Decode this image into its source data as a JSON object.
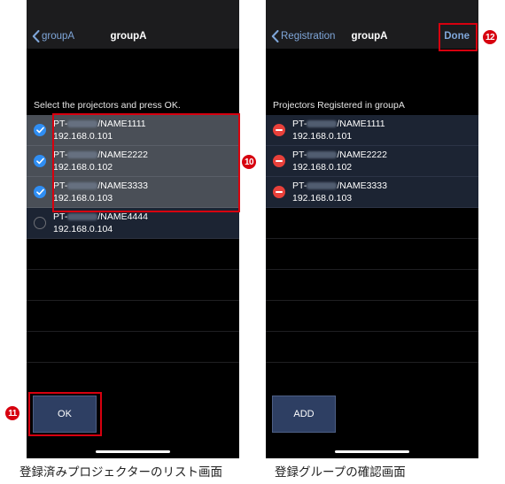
{
  "left_screen": {
    "nav": {
      "back_label": "groupA",
      "title": "groupA"
    },
    "section_header": "Select the projectors and press OK.",
    "projectors": [
      {
        "model_prefix": "PT-",
        "name": "/NAME1111",
        "ip": "192.168.0.101",
        "selected": true
      },
      {
        "model_prefix": "PT-",
        "name": "/NAME2222",
        "ip": "192.168.0.102",
        "selected": true
      },
      {
        "model_prefix": "PT-",
        "name": "/NAME3333",
        "ip": "192.168.0.103",
        "selected": true
      },
      {
        "model_prefix": "PT-",
        "name": "/NAME4444",
        "ip": "192.168.0.104",
        "selected": false
      }
    ],
    "ok_button_label": "OK",
    "caption": "登録済みプロジェクターのリスト画面"
  },
  "right_screen": {
    "nav": {
      "back_label": "Registration",
      "title": "groupA",
      "done_label": "Done"
    },
    "section_header": "Projectors Registered in groupA",
    "projectors": [
      {
        "model_prefix": "PT-",
        "name": "/NAME1111",
        "ip": "192.168.0.101"
      },
      {
        "model_prefix": "PT-",
        "name": "/NAME2222",
        "ip": "192.168.0.102"
      },
      {
        "model_prefix": "PT-",
        "name": "/NAME3333",
        "ip": "192.168.0.103"
      }
    ],
    "add_button_label": "ADD",
    "caption": "登録グループの確認画面"
  },
  "annotations": {
    "badge_10": "10",
    "badge_11": "11",
    "badge_12": "12",
    "highlight_color": "#d7000f"
  },
  "colors": {
    "accent_blue": "#2f8ef4",
    "delete_red": "#e8403a",
    "nav_link": "#7fa6d9",
    "button_bg": "#2e3f63"
  }
}
